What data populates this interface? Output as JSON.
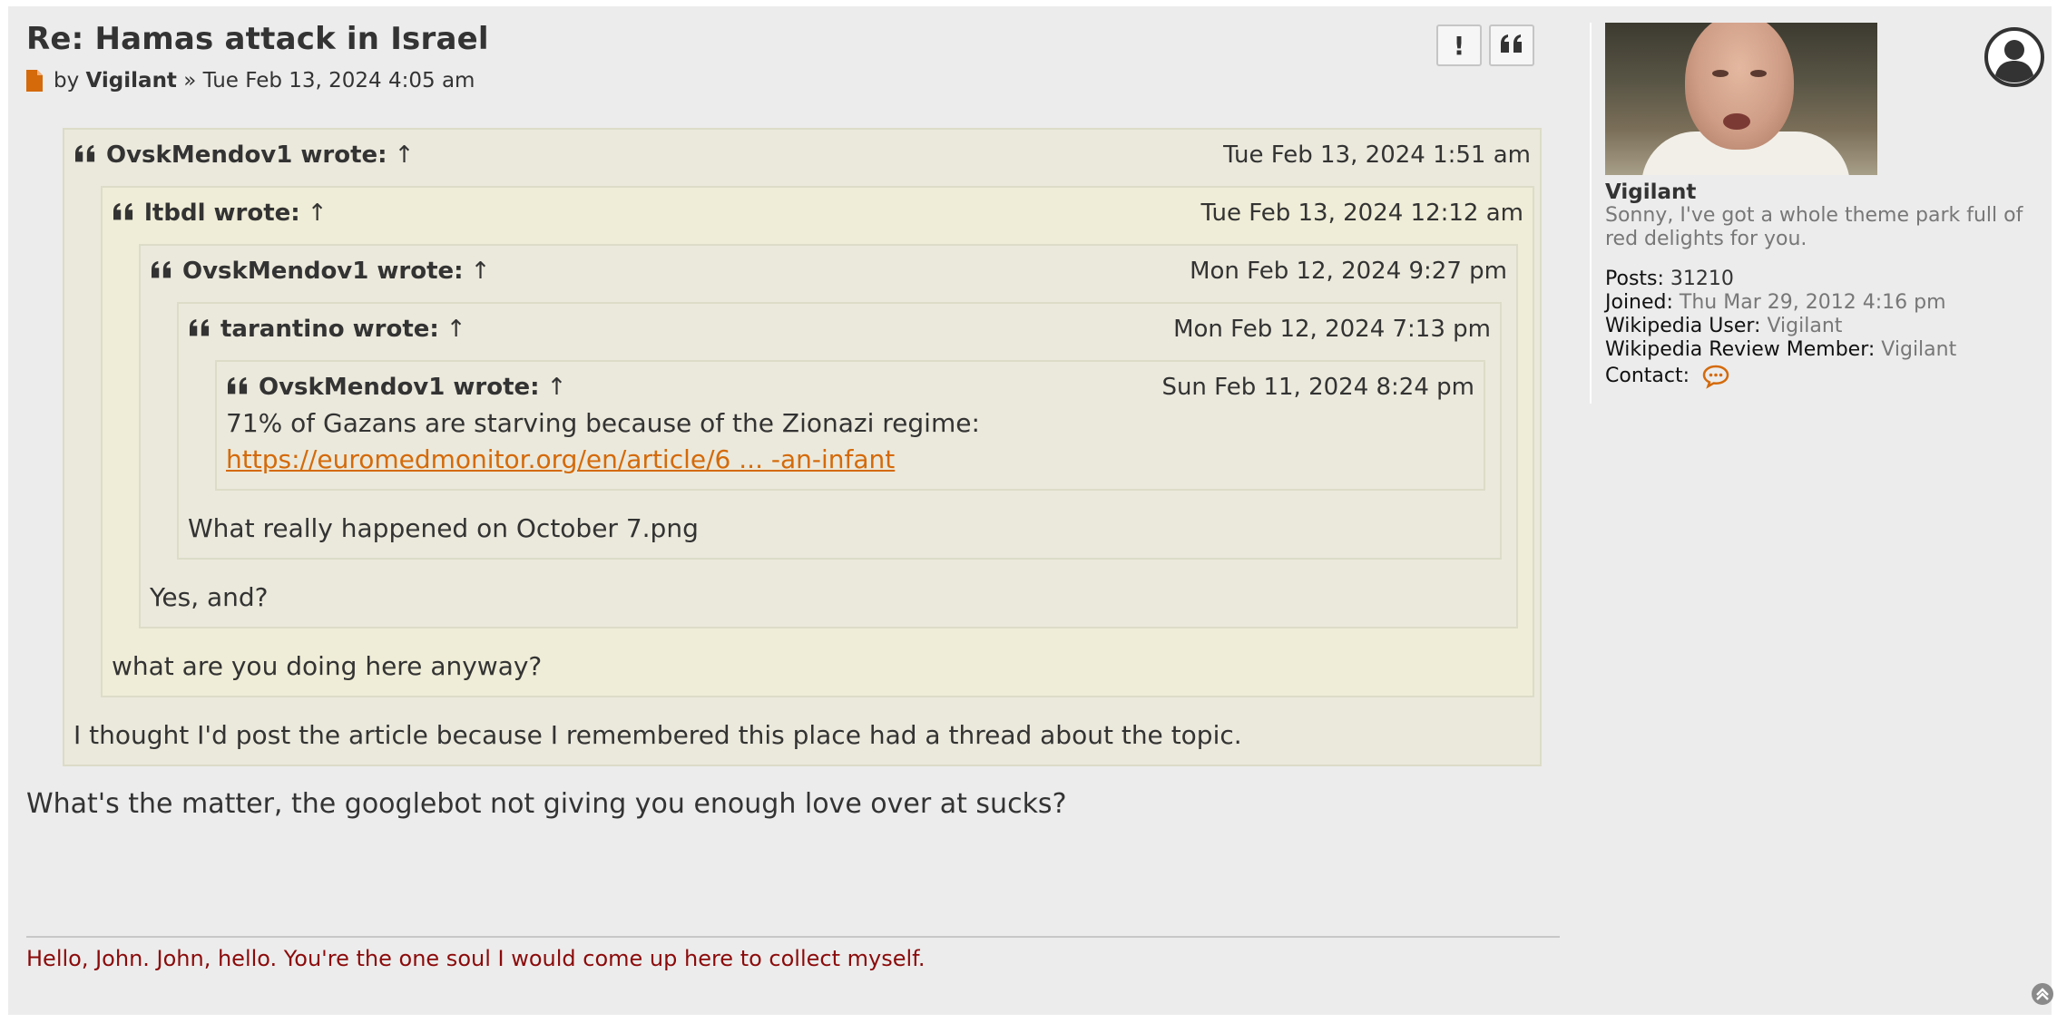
{
  "post": {
    "title": "Re: Hamas attack in Israel",
    "by_label": "by",
    "author": "Vigilant",
    "separator": "»",
    "date": "Tue Feb 13, 2024 4:05 am",
    "report_button": "!",
    "quote_button_icon": "quote-icon"
  },
  "quotes": {
    "q1": {
      "author": "OvskMendov1 wrote:",
      "arrow": "↑",
      "date": "Tue Feb 13, 2024 1:51 am",
      "text": "I thought I'd post the article because I remembered this place had a thread about the topic."
    },
    "q2": {
      "author": "ltbdl wrote:",
      "arrow": "↑",
      "date": "Tue Feb 13, 2024 12:12 am",
      "text": "what are you doing here anyway?"
    },
    "q3": {
      "author": "OvskMendov1 wrote:",
      "arrow": "↑",
      "date": "Mon Feb 12, 2024 9:27 pm",
      "text": "Yes, and?"
    },
    "q4": {
      "author": "tarantino wrote:",
      "arrow": "↑",
      "date": "Mon Feb 12, 2024 7:13 pm",
      "text": "What really happened on October 7.png"
    },
    "q5": {
      "author": "OvskMendov1 wrote:",
      "arrow": "↑",
      "date": "Sun Feb 11, 2024 8:24 pm",
      "text": "71% of Gazans are starving because of the Zionazi regime:",
      "link": "https://euromedmonitor.org/en/article/6 ... -an-infant"
    }
  },
  "reply_text": "What's the matter, the googlebot not giving you enough love over at sucks?",
  "signature": "Hello, John. John, hello. You're the one soul I would come up here to collect myself.",
  "profile": {
    "username": "Vigilant",
    "rank": "Sonny, I've got a whole theme park full of red delights for you.",
    "posts_label": "Posts:",
    "posts_value": "31210",
    "joined_label": "Joined:",
    "joined_value": "Thu Mar 29, 2012 4:16 pm",
    "wiki_user_label": "Wikipedia User:",
    "wiki_user_value": "Vigilant",
    "wiki_review_label": "Wikipedia Review Member:",
    "wiki_review_value": "Vigilant",
    "contact_label": "Contact:"
  },
  "colors": {
    "accent": "#d46a0a",
    "signature": "#8b0a0a",
    "quote_bg": "#ebe9dc",
    "post_bg": "#ececec"
  }
}
